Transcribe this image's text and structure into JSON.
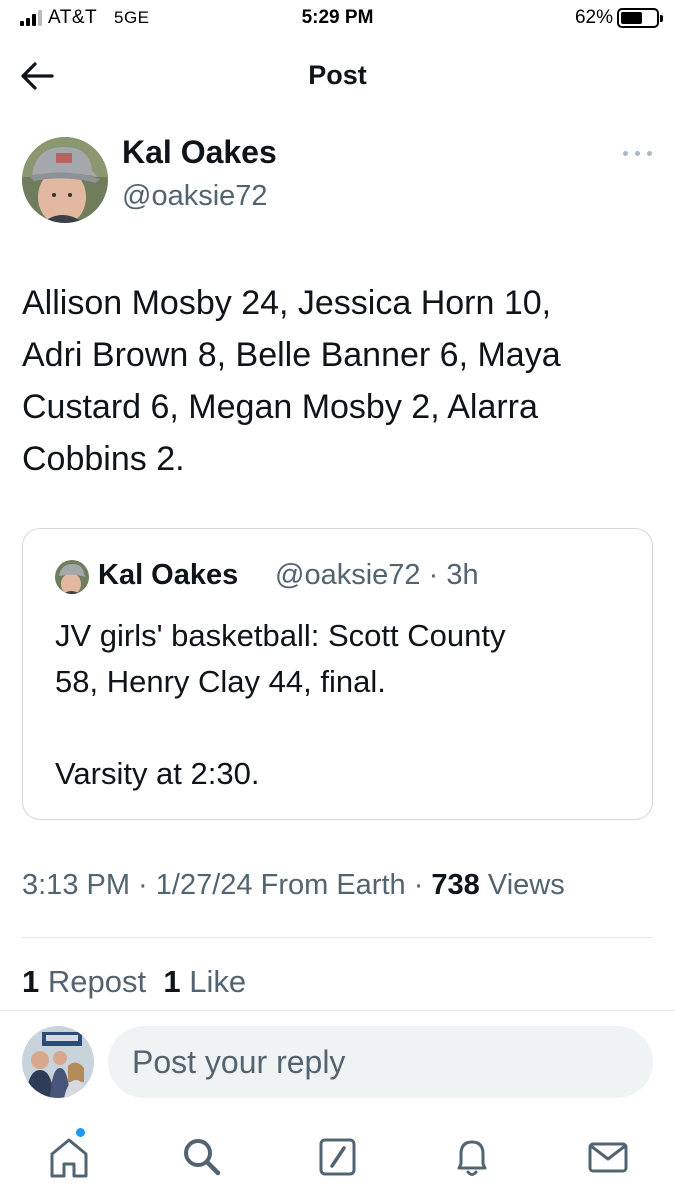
{
  "status_bar": {
    "carrier": "AT&T",
    "network": "5GE",
    "time": "5:29 PM",
    "battery_percent": "62%",
    "battery_level": 0.62
  },
  "header": {
    "title": "Post",
    "back_icon": "arrow-left-icon"
  },
  "post": {
    "author_name": "Kal Oakes",
    "author_handle": "@oaksie72",
    "more_icon": "more-horizontal-icon",
    "text": "Allison Mosby 24, Jessica Horn 10,\nAdri Brown 8, Belle Banner 6, Maya\nCustard 6, Megan Mosby 2, Alarra\nCobbins 2.",
    "time": "3:13 PM",
    "date": "1/27/24",
    "source": "From Earth",
    "views_count": "738",
    "views_label": "Views",
    "reposts_count": "1",
    "reposts_label": "Repost",
    "likes_count": "1",
    "likes_label": "Like"
  },
  "quote": {
    "author_name": "Kal Oakes",
    "author_handle": "@oaksie72",
    "age": "3h",
    "text": "JV girls' basketball: Scott County\n58, Henry Clay 44, final.\n\nVarsity at 2:30."
  },
  "reply": {
    "placeholder": "Post your reply"
  },
  "tabbar": {
    "items": [
      "home-icon",
      "search-icon",
      "compose-icon",
      "bell-icon",
      "mail-icon"
    ]
  },
  "colors": {
    "text": "#0f1419",
    "secondary": "#536471",
    "border": "#cfd9de",
    "accent": "#1d9bf0",
    "input_bg": "#eff3f4"
  }
}
